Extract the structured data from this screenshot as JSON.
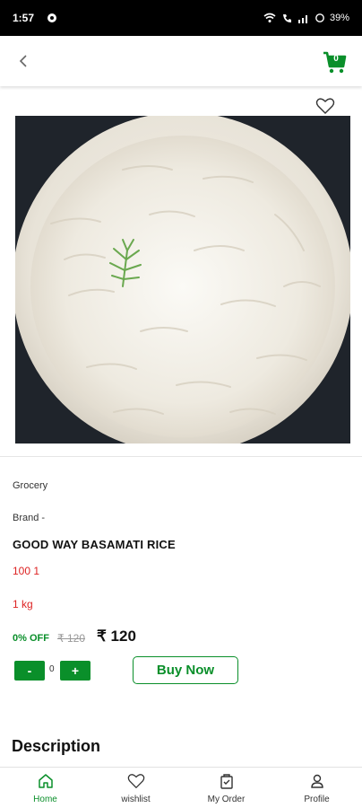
{
  "status_bar": {
    "time": "1:57",
    "battery": "39%"
  },
  "header": {
    "cart_count": "0"
  },
  "product": {
    "category": "Grocery",
    "brand": "Brand -",
    "name": "GOOD WAY BASAMATI RICE",
    "code": "100 1",
    "weight": "1 kg",
    "discount": "0% OFF",
    "mrp": "₹ 120",
    "price": "₹ 120",
    "quantity": "0",
    "buy_label": "Buy Now",
    "minus_label": "-",
    "plus_label": "+"
  },
  "description": {
    "title": "Description"
  },
  "bottom_nav": [
    {
      "label": "Home",
      "icon": "home-icon",
      "active": true
    },
    {
      "label": "wishlist",
      "icon": "heart-icon",
      "active": false
    },
    {
      "label": "My Order",
      "icon": "bag-icon",
      "active": false
    },
    {
      "label": "Profile",
      "icon": "user-icon",
      "active": false
    }
  ],
  "colors": {
    "accent": "#0a8f2a",
    "danger": "#dd2222"
  }
}
